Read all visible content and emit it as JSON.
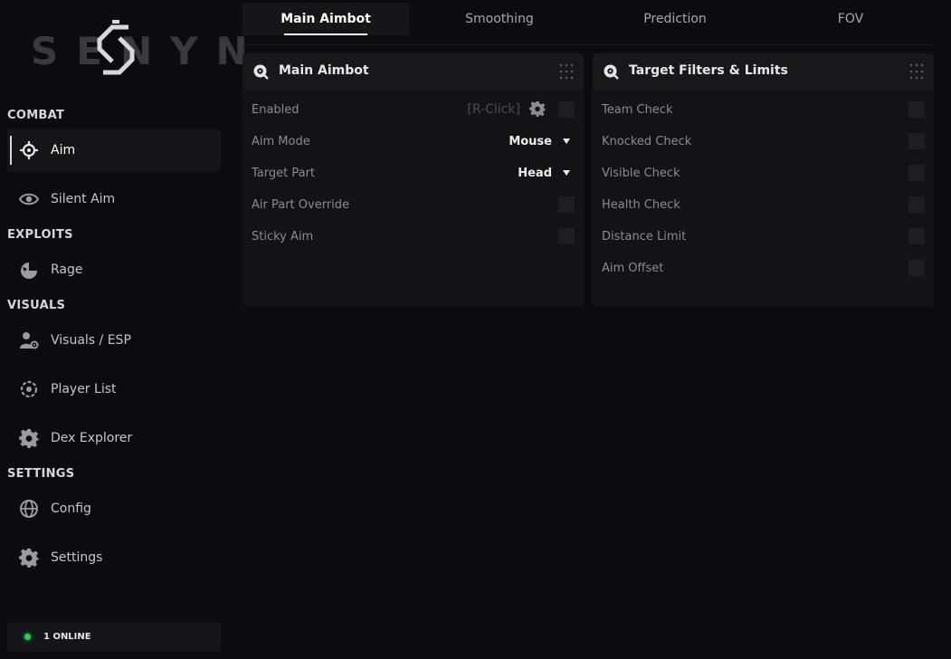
{
  "brand": {
    "logo_text": "SENYN"
  },
  "sidebar": {
    "sections": [
      {
        "title": "COMBAT"
      },
      {
        "title": "EXPLOITS"
      },
      {
        "title": "VISUALS"
      },
      {
        "title": "SETTINGS"
      }
    ],
    "items": [
      {
        "label": "Aim",
        "icon": "crosshair-icon",
        "active": true
      },
      {
        "label": "Silent Aim",
        "icon": "eye-icon"
      },
      {
        "label": "Rage",
        "icon": "rage-icon"
      },
      {
        "label": "Visuals / ESP",
        "icon": "user-settings-icon"
      },
      {
        "label": "Player List",
        "icon": "player-list-icon"
      },
      {
        "label": "Dex Explorer",
        "icon": "gear-icon"
      },
      {
        "label": "Config",
        "icon": "globe-icon"
      },
      {
        "label": "Settings",
        "icon": "gear-icon"
      }
    ],
    "status": {
      "text": "1 ONLINE",
      "color": "#2ecc5a"
    }
  },
  "tabs": [
    {
      "label": "Main Aimbot",
      "active": true
    },
    {
      "label": "Smoothing"
    },
    {
      "label": "Prediction"
    },
    {
      "label": "FOV"
    }
  ],
  "panels": {
    "main_aimbot": {
      "title": "Main Aimbot",
      "rows": {
        "enabled": {
          "label": "Enabled",
          "keybind": "[R-Click]",
          "checked": false
        },
        "aim_mode": {
          "label": "Aim Mode",
          "value": "Mouse"
        },
        "target_part": {
          "label": "Target Part",
          "value": "Head"
        },
        "air_part_override": {
          "label": "Air Part Override",
          "checked": false
        },
        "sticky_aim": {
          "label": "Sticky Aim",
          "checked": false
        }
      }
    },
    "target_filters": {
      "title": "Target Filters & Limits",
      "rows": [
        {
          "label": "Team Check",
          "checked": false
        },
        {
          "label": "Knocked Check",
          "checked": false
        },
        {
          "label": "Visible Check",
          "checked": false
        },
        {
          "label": "Health Check",
          "checked": false
        },
        {
          "label": "Distance Limit",
          "checked": false
        },
        {
          "label": "Aim Offset",
          "checked": false
        }
      ]
    }
  },
  "colors": {
    "background": "#0c0c0e",
    "panel": "#131316",
    "accent": "#ffffff",
    "online": "#2ecc5a"
  }
}
